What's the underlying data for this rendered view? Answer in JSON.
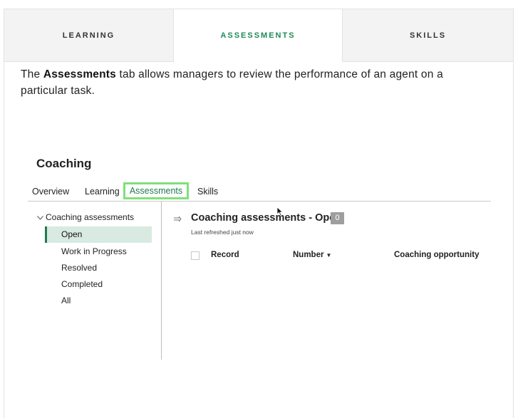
{
  "tabs": [
    {
      "label": "LEARNING",
      "active": false
    },
    {
      "label": "ASSESSMENTS",
      "active": true
    },
    {
      "label": "SKILLS",
      "active": false
    }
  ],
  "intro": {
    "prefix": "The ",
    "bold": "Assessments",
    "suffix": " tab allows managers to review the performance of an agent on a particular task."
  },
  "app": {
    "title": "Coaching",
    "subnav": [
      "Overview",
      "Learning",
      "Assessments",
      "Skills"
    ],
    "highlighted_subnav": "Assessments"
  },
  "tree": {
    "heading": "Coaching assessments",
    "items": [
      "Open",
      "Work in Progress",
      "Resolved",
      "Completed",
      "All"
    ],
    "selected": "Open"
  },
  "list": {
    "title": "Coaching assessments - Open",
    "count": "0",
    "refreshed": "Last refreshed just now",
    "columns": [
      "Record",
      "Number",
      "Coaching opportunity"
    ]
  },
  "colors": {
    "accent": "#1f8a57",
    "highlight_box": "#7fe07a",
    "selected_row": "#d8eae1"
  }
}
